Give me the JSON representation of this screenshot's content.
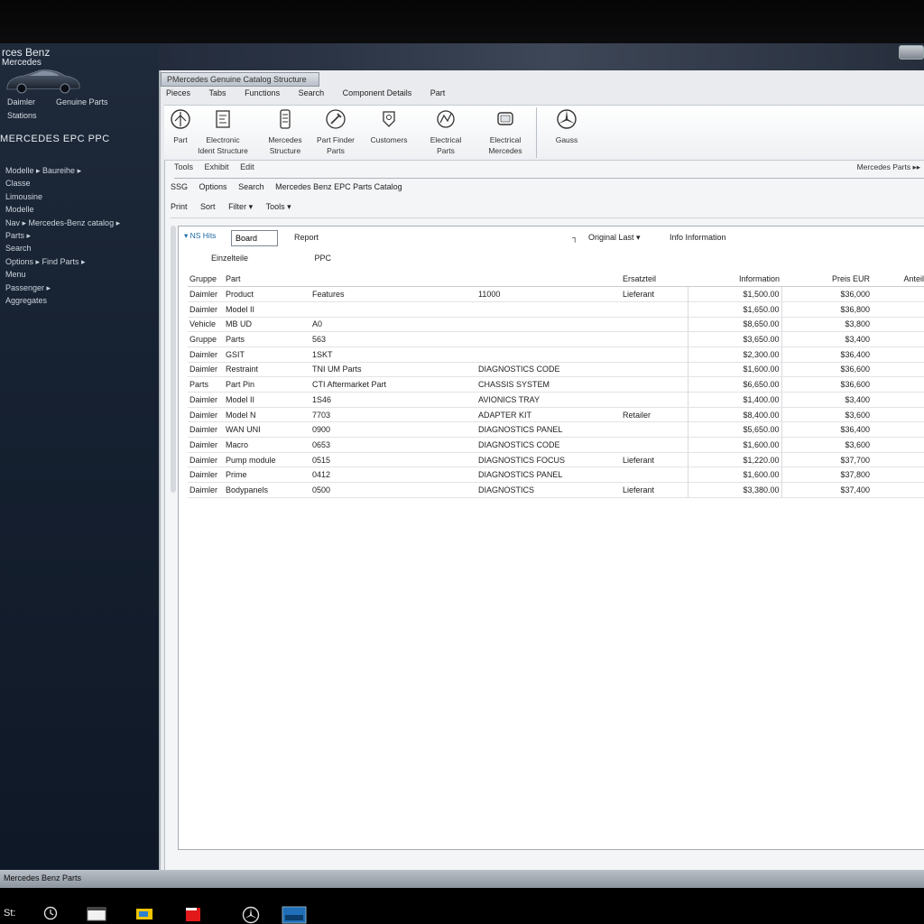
{
  "window": {
    "brand_line1": "rces Benz",
    "brand_line2": "Mercedes"
  },
  "sidebar": {
    "hdr_left": "Daimler",
    "hdr_right": "Genuine Parts",
    "sub": "Stations",
    "title": "MERCEDES EPC PPC",
    "items": [
      "Modelle ▸ Baureihe ▸",
      "Classe",
      "Limousine",
      "Modelle",
      "Nav ▸ Mercedes-Benz catalog ▸",
      "Parts ▸",
      "Search",
      "Options ▸ Find Parts ▸",
      "Menu",
      "Passenger ▸",
      "Aggregates"
    ]
  },
  "main": {
    "tab_label": "PMercedes   Genuine Catalog Structure",
    "menu": [
      "Pieces",
      "Tabs",
      "Functions",
      "Search",
      "Component Details",
      "Part"
    ],
    "ribbon": [
      {
        "label1": "Part",
        "label2": ""
      },
      {
        "label1": "Electronic",
        "label2": "Ident Structure"
      },
      {
        "label1": "Mercedes",
        "label2": "Structure"
      },
      {
        "label1": "Part Finder",
        "label2": "Parts"
      },
      {
        "label1": "Customers",
        "label2": ""
      },
      {
        "label1": "Electrical",
        "label2": "Parts"
      },
      {
        "label1": "Electrical",
        "label2": "Mercedes"
      },
      {
        "label1": "Gauss",
        "label2": ""
      }
    ],
    "tabs": [
      "Tools",
      "Exhibit",
      "Edit"
    ],
    "right_link": "Mercedes Parts ▸▸",
    "toolbar1": [
      "SSG",
      "Options",
      "Search",
      "Mercedes Benz EPC Parts Catalog"
    ],
    "toolbar2": [
      "Print",
      "Sort",
      "Filter ▾",
      "Tools ▾"
    ]
  },
  "filter": {
    "search_chip": "▾ NS Hits",
    "search_value": "Board",
    "report": "Report",
    "dropdown": "Original Last",
    "info": "Info Information"
  },
  "table": {
    "subheader_a": "Einzelteile",
    "subheader_b": "PPC",
    "headers": [
      "Gruppe",
      "Part",
      "",
      "",
      "Ersatzteil",
      "Information",
      "Preis EUR",
      "Anteil"
    ],
    "rows": [
      [
        "Daimler",
        "Product",
        "Features",
        "11000",
        "Lieferant",
        "$1,500.00",
        "$36,000",
        ""
      ],
      [
        "Daimler",
        "Model II",
        "",
        "",
        "",
        "$1,650.00",
        "$36,800",
        ""
      ],
      [
        "Vehicle",
        "MB UD",
        "A0",
        "",
        "",
        "$8,650.00",
        "$3,800",
        ""
      ],
      [
        "Gruppe",
        "Parts",
        "563",
        "",
        "",
        "$3,650.00",
        "$3,400",
        ""
      ],
      [
        "Daimler",
        "GSIT",
        "1SKT",
        "",
        "",
        "$2,300.00",
        "$36,400",
        ""
      ],
      [
        "Daimler",
        "Restraint",
        "TNI UM Parts",
        "DIAGNOSTICS CODE",
        "",
        "$1,600.00",
        "$36,600",
        ""
      ],
      [
        "Parts",
        "Part Pin",
        "CTI Aftermarket Part",
        "CHASSIS SYSTEM",
        "",
        "$6,650.00",
        "$36,600",
        ""
      ],
      [
        "Daimler",
        "Model II",
        "1S46",
        "AVIONICS TRAY",
        "",
        "$1,400.00",
        "$3,400",
        ""
      ],
      [
        "Daimler",
        "Model N",
        "7703",
        "ADAPTER KIT",
        "Retailer",
        "$8,400.00",
        "$3,600",
        ""
      ],
      [
        "Daimler",
        "WAN UNI",
        "0900",
        "DIAGNOSTICS PANEL",
        "",
        "$5,650.00",
        "$36,400",
        ""
      ],
      [
        "Daimler",
        "Macro",
        "0653",
        "DIAGNOSTICS CODE",
        "",
        "$1,600.00",
        "$3,600",
        ""
      ],
      [
        "Daimler",
        "Pump module",
        "0515",
        "DIAGNOSTICS FOCUS",
        "Lieferant",
        "$1,220.00",
        "$37,700",
        ""
      ],
      [
        "Daimler",
        "Prime",
        "0412",
        "DIAGNOSTICS PANEL",
        "",
        "$1,600.00",
        "$37,800",
        ""
      ],
      [
        "Daimler",
        "Bodypanels",
        "0500",
        "DIAGNOSTICS",
        "Lieferant",
        "$3,380.00",
        "$37,400",
        ""
      ]
    ]
  },
  "statusbar": "Mercedes Benz Parts",
  "taskbar": {
    "start_label": "St:"
  }
}
